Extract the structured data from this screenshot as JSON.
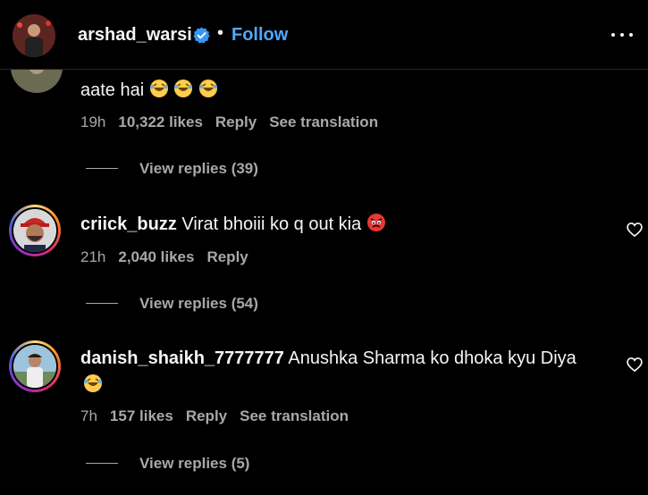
{
  "header": {
    "username": "arshad_warsi",
    "separator": "•",
    "follow_label": "Follow"
  },
  "comments": [
    {
      "text": "aate hai",
      "emojis": [
        "laughing-emoji",
        "laughing-emoji",
        "laughing-emoji"
      ],
      "time": "19h",
      "likes": "10,322 likes",
      "reply_label": "Reply",
      "translation_label": "See translation",
      "view_replies": "View replies (39)"
    },
    {
      "username": "criick_buzz",
      "text": "Virat bhoiii ko q out kia",
      "emojis": [
        "angry-emoji"
      ],
      "time": "21h",
      "likes": "2,040 likes",
      "reply_label": "Reply",
      "view_replies": "View replies (54)"
    },
    {
      "username": "danish_shaikh_7777777",
      "text": "Anushka Sharma ko dhoka kyu Diya",
      "emojis": [
        "laughing-emoji"
      ],
      "time": "7h",
      "likes": "157 likes",
      "reply_label": "Reply",
      "translation_label": "See translation",
      "view_replies": "View replies (5)"
    }
  ],
  "colors": {
    "background": "#000000",
    "text": "#f5f5f5",
    "secondary": "#a8a8a8",
    "link": "#4fa8ff",
    "verified": "#3897f0"
  }
}
